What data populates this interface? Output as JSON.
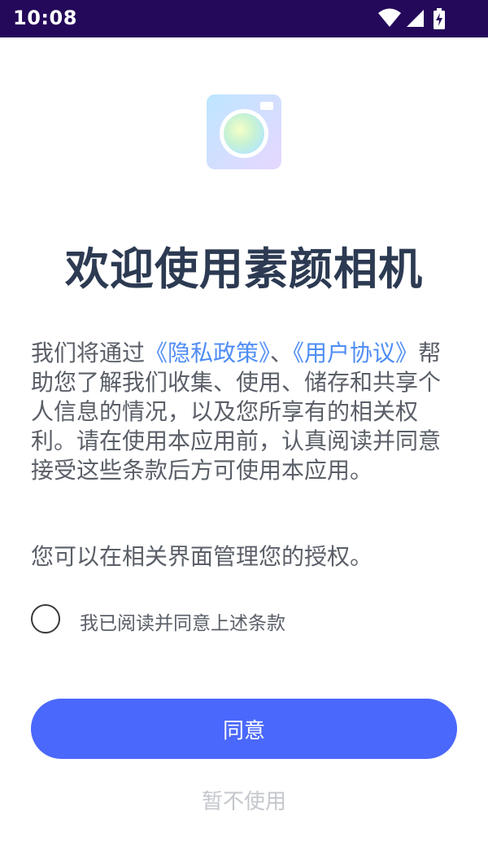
{
  "status_bar": {
    "time": "10:08"
  },
  "app": {
    "icon": "camera-icon",
    "title": "欢迎使用素颜相机"
  },
  "intro": {
    "text_before": "我们将通过",
    "privacy_link": "《隐私政策》",
    "separator": "、",
    "user_agreement_link": "《用户协议》",
    "text_after": "帮助您了解我们收集、使用、储存和共享个人信息的情况，以及您所享有的相关权利。请在使用本应用前，认真阅读并同意接受这些条款后方可使用本应用。"
  },
  "note": {
    "text": "您可以在相关界面管理您的授权。"
  },
  "consent": {
    "checked": false,
    "label": "我已阅读并同意上述条款"
  },
  "buttons": {
    "agree": "同意",
    "decline": "暂不使用"
  },
  "colors": {
    "status_bar": "#24085a",
    "title": "#2c3a52",
    "body_text": "#5a5f68",
    "link": "#4f8df5",
    "primary_button": "#4a68fb",
    "decline_text": "#c4c7cc"
  }
}
